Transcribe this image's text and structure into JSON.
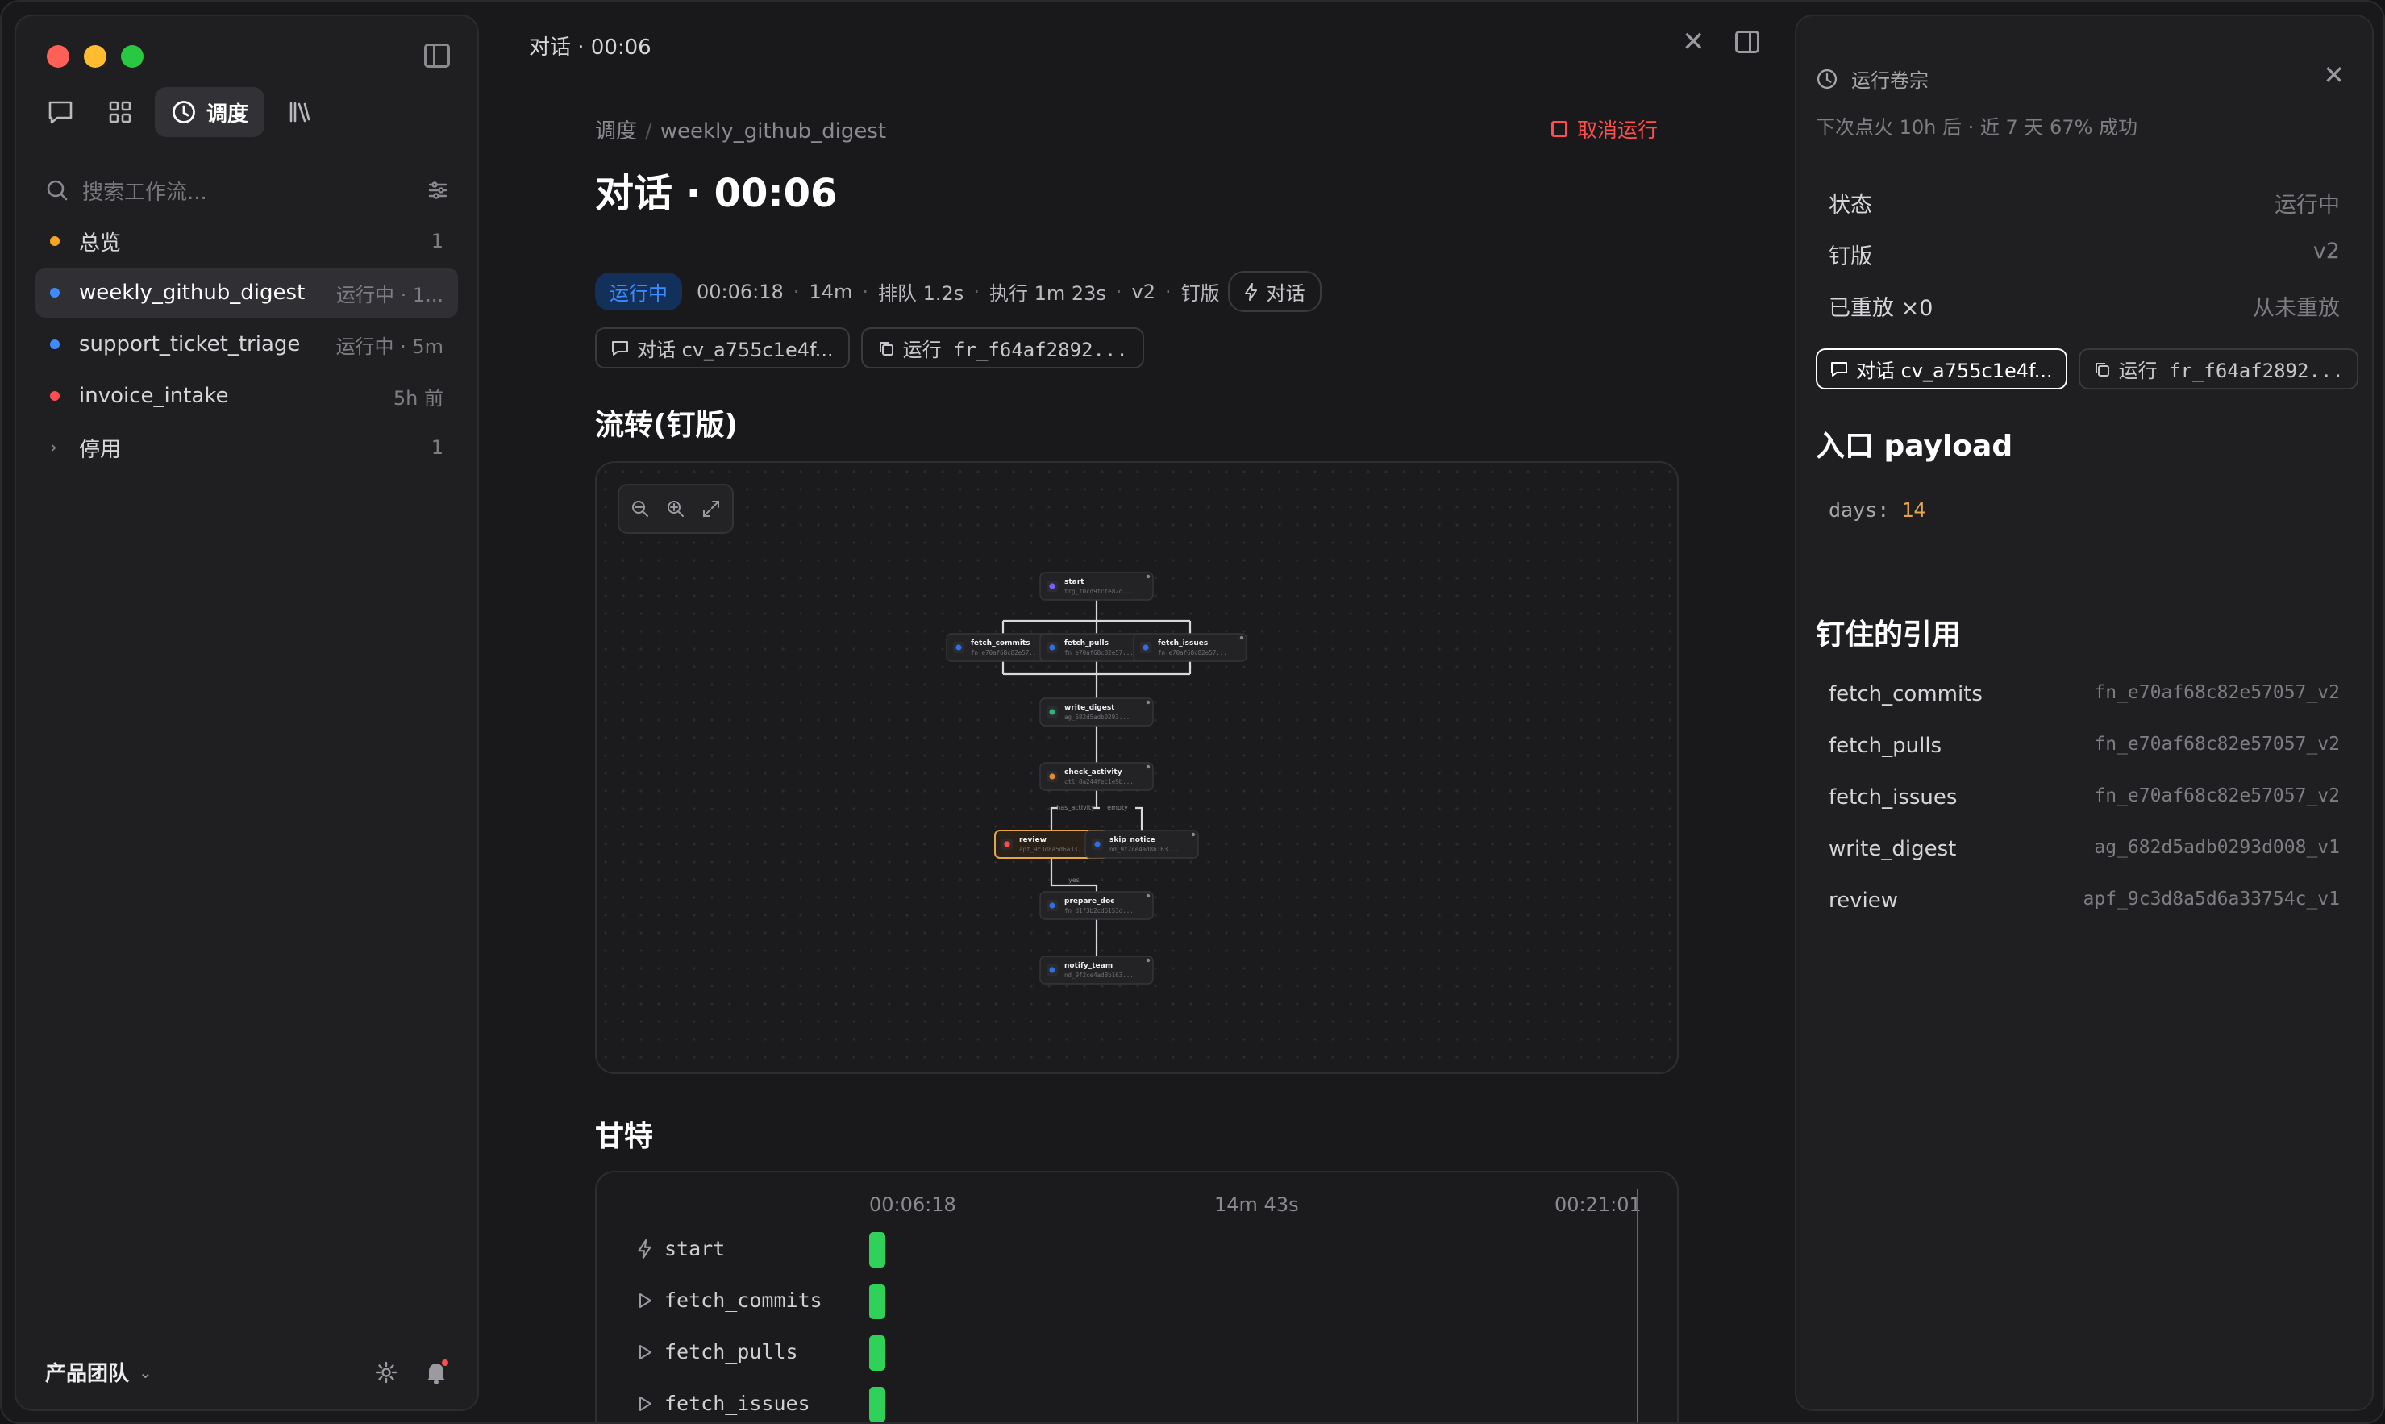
{
  "sidebar": {
    "nav": {
      "schedule_label": "调度"
    },
    "search_placeholder": "搜索工作流...",
    "items": [
      {
        "name": "总览",
        "meta": "1",
        "dot": "#f5a524"
      },
      {
        "name": "weekly_github_digest",
        "meta": "运行中 · 1...",
        "dot": "#3d8bff"
      },
      {
        "name": "support_ticket_triage",
        "meta": "运行中 · 5m",
        "dot": "#3d8bff"
      },
      {
        "name": "invoice_intake",
        "meta": "5h 前",
        "dot": "#ff4d4f"
      },
      {
        "name": "停用",
        "meta": "1"
      }
    ],
    "team": "产品团队"
  },
  "topbar": {
    "title": "对话 · 00:06"
  },
  "main": {
    "breadcrumb": {
      "root": "调度",
      "current": "weekly_github_digest"
    },
    "cancel_label": "取消运行",
    "title": "对话 · 00:06",
    "status": "运行中",
    "stats": {
      "elapsed": "00:06:18",
      "duration": "14m",
      "queue": "排队 1.2s",
      "exec": "执行 1m 23s",
      "version": "v2",
      "pinned": "钉版",
      "trigger": "对话"
    },
    "refs": {
      "conversation": "对话 cv_a755c1e4f...",
      "run": "运行 fr_f64af2892..."
    },
    "flow_title": "流转(钉版)",
    "flow_nodes": [
      {
        "name": "start",
        "id": "trg_f0cd9fcfe82d..."
      },
      {
        "name": "fetch_commits",
        "id": "fn_e70af68c82e57..."
      },
      {
        "name": "fetch_pulls",
        "id": "fn_e70af68c82e57..."
      },
      {
        "name": "fetch_issues",
        "id": "fn_e70af68c82e57..."
      },
      {
        "name": "write_digest",
        "id": "ag_682d5adb0293..."
      },
      {
        "name": "check_activity",
        "id": "ctl_8a244fec1e9b..."
      },
      {
        "name": "review",
        "id": "apf_9c3d8a5d6a33..."
      },
      {
        "name": "skip_notice",
        "id": "nd_9f2ce4ad8b163..."
      },
      {
        "name": "prepare_doc",
        "id": "fn_d1f3b2cd6153d..."
      },
      {
        "name": "notify_team",
        "id": "nd_9f2ce4ad8b163..."
      }
    ],
    "flow_edges": {
      "has_activity": "has_activity",
      "empty": "empty",
      "yes": "yes"
    },
    "gantt_title": "甘特",
    "gantt": {
      "axis": [
        "00:06:18",
        "14m 43s",
        "00:21:01"
      ],
      "rows": [
        {
          "label": "start",
          "icon": "bolt-icon"
        },
        {
          "label": "fetch_commits",
          "icon": "play-icon"
        },
        {
          "label": "fetch_pulls",
          "icon": "play-icon"
        },
        {
          "label": "fetch_issues",
          "icon": "play-icon"
        }
      ]
    }
  },
  "right": {
    "title": "运行卷宗",
    "subtitle": "下次点火 10h 后 · 近 7 天 67% 成功",
    "kv": [
      {
        "k": "状态",
        "v": "运行中"
      },
      {
        "k": "钉版",
        "v": "v2"
      },
      {
        "k": "已重放 ×0",
        "v": "从未重放"
      }
    ],
    "refs": {
      "conversation": "对话 cv_a755c1e4f...",
      "run": "运行 fr_f64af2892..."
    },
    "payload_title": "入口 payload",
    "payload": {
      "key": "days:",
      "value": "14"
    },
    "pinned_title": "钉住的引用",
    "pinned": [
      {
        "k": "fetch_commits",
        "v": "fn_e70af68c82e57057_v2"
      },
      {
        "k": "fetch_pulls",
        "v": "fn_e70af68c82e57057_v2"
      },
      {
        "k": "fetch_issues",
        "v": "fn_e70af68c82e57057_v2"
      },
      {
        "k": "write_digest",
        "v": "ag_682d5adb0293d008_v1"
      },
      {
        "k": "review",
        "v": "apf_9c3d8a5d6a33754c_v1"
      }
    ]
  },
  "colors": {
    "accent_blue": "#3d8bff",
    "danger": "#ff4d4f",
    "success": "#2fd158",
    "warn": "#f5a524"
  }
}
